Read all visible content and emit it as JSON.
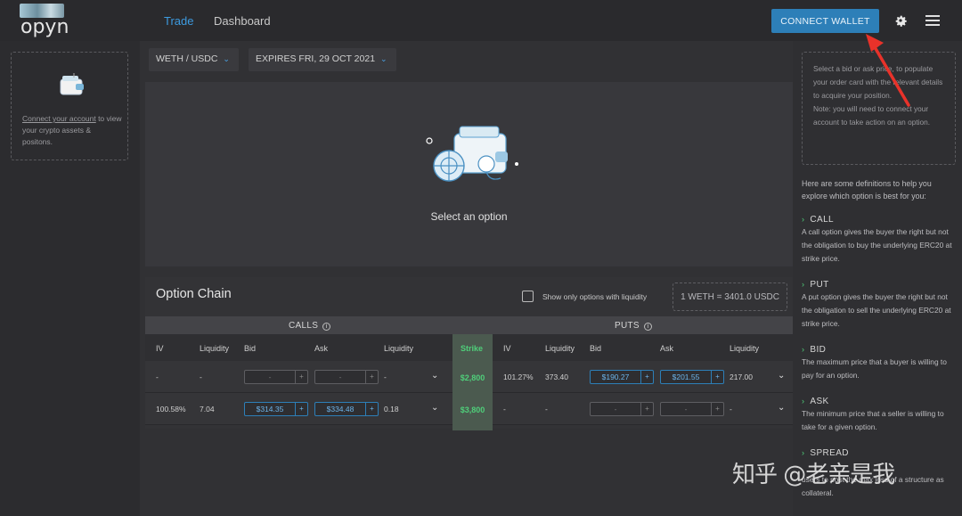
{
  "header": {
    "logo_text": "opyn",
    "nav": {
      "trade": "Trade",
      "dashboard": "Dashboard"
    },
    "connect_label": "CONNECT WALLET"
  },
  "left": {
    "link": "Connect your account",
    "text": " to view your crypto assets & positons."
  },
  "selectors": {
    "pair": "WETH / USDC",
    "expiry": "EXPIRES FRI, 29 OCT 2021"
  },
  "option_card": {
    "prompt": "Select an option"
  },
  "chain": {
    "title": "Option Chain",
    "filter_label": "Show only options with liquidity",
    "rate": "1 WETH = 3401.0 USDC",
    "calls_label": "CALLS",
    "puts_label": "PUTS",
    "headers": {
      "iv": "IV",
      "liquidity": "Liquidity",
      "bid": "Bid",
      "ask": "Ask",
      "liquidity2": "Liquidity",
      "strike": "Strike",
      "p_iv": "IV",
      "p_liquidity": "Liquidity",
      "p_bid": "Bid",
      "p_ask": "Ask",
      "p_liquidity2": "Liquidity"
    },
    "rows": [
      {
        "c_iv": "-",
        "c_liq": "-",
        "c_bid": "-",
        "c_ask": "-",
        "c_liq2": "-",
        "strike": "$2,800",
        "p_iv": "101.27%",
        "p_liq": "373.40",
        "p_bid": "$190.27",
        "p_ask": "$201.55",
        "p_liq2": "217.00"
      },
      {
        "c_iv": "100.58%",
        "c_liq": "7.04",
        "c_bid": "$314.35",
        "c_ask": "$334.48",
        "c_liq2": "0.18",
        "strike": "$3,800",
        "p_iv": "-",
        "p_liq": "-",
        "p_bid": "-",
        "p_ask": "-",
        "p_liq2": "-"
      }
    ]
  },
  "right": {
    "tip": "Select a bid or ask price, to populate your order card with the relevant details to acquire your position.",
    "note": "Note: you will need to connect your account to take action on an option.",
    "intro": "Here are some definitions to help you explore which option is best for you:",
    "defs": [
      {
        "title": "CALL",
        "text": "A call option gives the buyer the right but not the obligation to buy the underlying ERC20 at strike price."
      },
      {
        "title": "PUT",
        "text": "A put option gives the buyer the right but not the obligation to sell the underlying ERC20 at strike price."
      },
      {
        "title": "BID",
        "text": "The maximum price that a buyer is willing to pay for an option."
      },
      {
        "title": "ASK",
        "text": "The minimum price that a seller is willing to take for a given option."
      },
      {
        "title": "SPREAD",
        "text": "users to post the max loss of a structure as collateral."
      }
    ]
  },
  "watermark": "知乎 @老亲是我"
}
